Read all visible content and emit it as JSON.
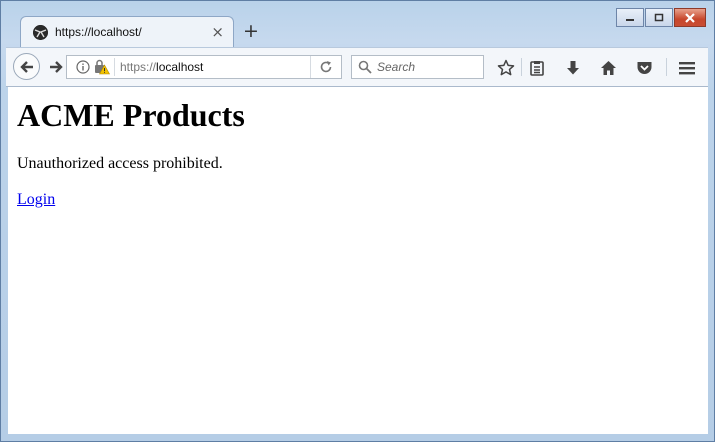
{
  "tab": {
    "title": "https://localhost/",
    "close": "×"
  },
  "newtab": "+",
  "urlbar": {
    "scheme": "https://",
    "host": "localhost"
  },
  "search": {
    "placeholder": "Search"
  },
  "page": {
    "heading": "ACME Products",
    "message": "Unauthorized access prohibited.",
    "link": "Login"
  }
}
